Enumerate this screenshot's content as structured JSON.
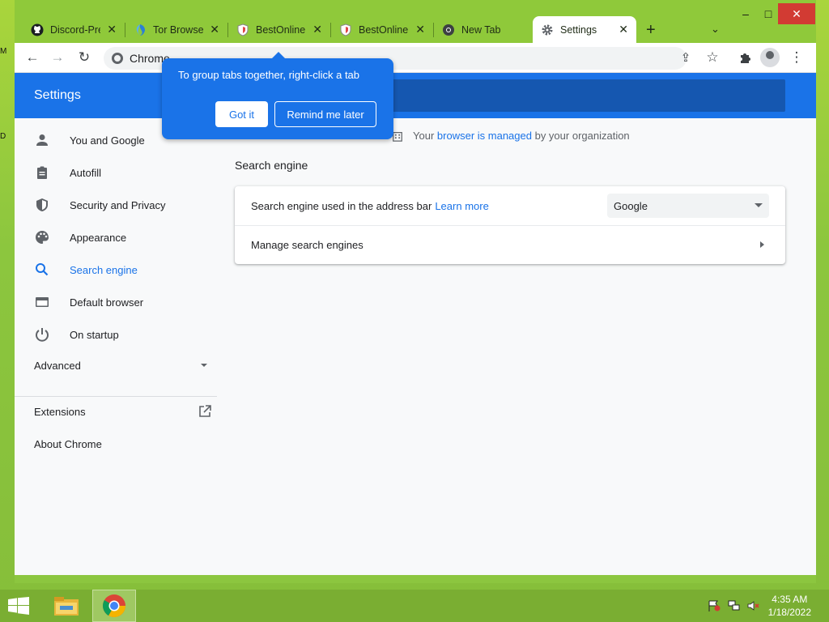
{
  "desktop": {
    "frag_top": "M",
    "frag_mid": "D"
  },
  "tabs": [
    {
      "title": "Discord-Pre",
      "icon": "github-icon",
      "active": false
    },
    {
      "title": "Tor Browser",
      "icon": "tor-icon",
      "active": false
    },
    {
      "title": "BestOnline",
      "icon": "shield-icon",
      "active": false
    },
    {
      "title": "BestOnline",
      "icon": "shield-icon",
      "active": false
    },
    {
      "title": "New Tab",
      "icon": "chrome-icon",
      "active": false
    },
    {
      "title": "Settings",
      "icon": "gear-icon",
      "active": true
    }
  ],
  "window_controls": {
    "minimize": "–",
    "maximize": "□",
    "close": "✕"
  },
  "toolbar": {
    "omnibox_text": "Chrome"
  },
  "settings": {
    "header_title": "Settings",
    "managed_prefix": "Your",
    "managed_link": "browser is managed",
    "managed_suffix": "by your organization",
    "nav": [
      {
        "label": "You and Google",
        "icon": "person-icon"
      },
      {
        "label": "Autofill",
        "icon": "clipboard-icon"
      },
      {
        "label": "Security and Privacy",
        "icon": "shield-icon"
      },
      {
        "label": "Appearance",
        "icon": "palette-icon"
      },
      {
        "label": "Search engine",
        "icon": "search-icon",
        "selected": true
      },
      {
        "label": "Default browser",
        "icon": "browser-icon"
      },
      {
        "label": "On startup",
        "icon": "power-icon"
      }
    ],
    "advanced_label": "Advanced",
    "extensions_label": "Extensions",
    "about_label": "About Chrome",
    "section_title": "Search engine",
    "row1_label": "Search engine used in the address bar",
    "row1_link": "Learn more",
    "row1_select": "Google",
    "row2_label": "Manage search engines"
  },
  "bubble": {
    "text": "To group tabs together, right-click a tab",
    "got_it": "Got it",
    "remind": "Remind me later"
  },
  "taskbar": {
    "time": "4:35 AM",
    "date": "1/18/2022"
  },
  "colors": {
    "accent": "#1a73e8",
    "tabstrip": "#8fc93a",
    "close_red": "#d23b33"
  }
}
